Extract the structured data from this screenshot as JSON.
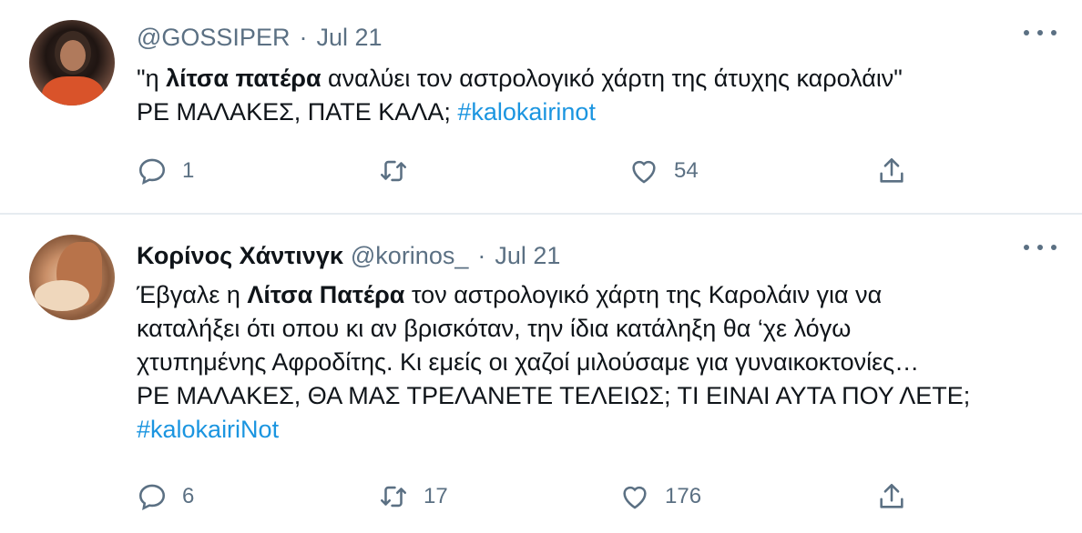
{
  "tweets": [
    {
      "handle": "@GOSSIPER",
      "date": "Jul 21",
      "body_lines": [
        [
          "\"η ",
          {
            "bold": "λίτσα πατέρα"
          },
          " αναλύει τον αστρολογικό χάρτη της άτυχης καρολάιν\""
        ],
        [
          "ΡΕ ΜΑΛΑΚΕΣ, ΠΑΤΕ ΚΑΛΑ; ",
          {
            "hashtag": "#kalokairinot"
          }
        ]
      ],
      "replies": "1",
      "retweets": "",
      "likes": "54"
    },
    {
      "display_name": "Κορίνος Χάντινγκ",
      "handle": "@korinos_",
      "date": "Jul 21",
      "body_lines": [
        [
          "Έβγαλε η ",
          {
            "bold": "Λίτσα Πατέρα"
          },
          " τον αστρολογικό χάρτη της Καρολάιν για να"
        ],
        [
          "καταλήξει ότι οπου κι αν βρισκόταν, την ίδια κατάληξη θα ‘χε λόγω"
        ],
        [
          "χτυπημένης Αφροδίτης. Κι εμείς οι χαζοί μιλούσαμε για γυναικοκτονίες…"
        ],
        [
          "ΡΕ ΜΑΛΑΚΕΣ, ΘΑ ΜΑΣ ΤΡΕΛΑΝΕΤΕ ΤΕΛΕΙΩΣ; ΤΙ ΕΙΝΑΙ ΑΥΤΑ ΠΟΥ ΛΕΤΕ;"
        ],
        [
          {
            "hashtag": "#kalokairiNot"
          }
        ]
      ],
      "replies": "6",
      "retweets": "17",
      "likes": "176"
    }
  ],
  "icons": {
    "reply": "reply-icon",
    "retweet": "retweet-icon",
    "like": "heart-icon",
    "share": "share-icon",
    "more": "more-icon"
  },
  "colors": {
    "text": "#0f1419",
    "secondary": "#5b7083",
    "hashtag": "#1b95e0",
    "divider": "#e6ecf0"
  }
}
